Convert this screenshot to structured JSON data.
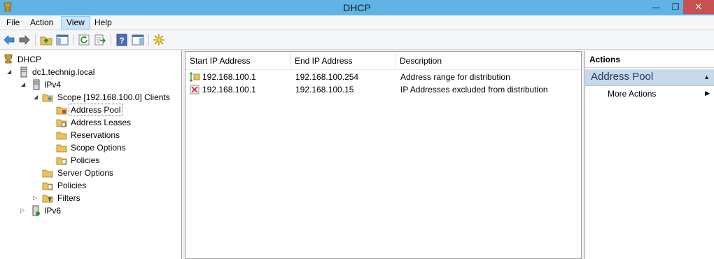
{
  "window": {
    "title": "DHCP",
    "min_glyph": "—",
    "max_glyph": "❐",
    "close_glyph": "✕"
  },
  "menu": {
    "file": "File",
    "action": "Action",
    "view": "View",
    "help": "Help"
  },
  "toolbar": {
    "icons": [
      "back-arrow-icon",
      "forward-arrow-icon",
      "up-folder-icon",
      "show-hide-tree-icon",
      "refresh-icon",
      "export-list-icon",
      "help-icon",
      "show-hide-action-pane-icon",
      "new-icon"
    ]
  },
  "tree": {
    "root": "DHCP",
    "server": "dc1.technig.local",
    "ipv4": "IPv4",
    "scope": "Scope [192.168.100.0] Clients",
    "address_pool": "Address Pool",
    "address_leases": "Address Leases",
    "reservations": "Reservations",
    "scope_options": "Scope Options",
    "scope_policies": "Policies",
    "server_options": "Server Options",
    "policies": "Policies",
    "filters": "Filters",
    "ipv6": "IPv6"
  },
  "list": {
    "columns": [
      "Start IP Address",
      "End IP Address",
      "Description"
    ],
    "rows": [
      {
        "start": "192.168.100.1",
        "end": "192.168.100.254",
        "description": "Address range for distribution",
        "icon": "address-range-icon"
      },
      {
        "start": "192.168.100.1",
        "end": "192.168.100.15",
        "description": "IP Addresses excluded from distribution",
        "icon": "exclusion-range-icon"
      }
    ]
  },
  "actions": {
    "title": "Actions",
    "section": "Address Pool",
    "more": "More Actions"
  },
  "colors": {
    "titlebar": "#5fb4e5",
    "close": "#c75050",
    "action_section": "#c9d9ec"
  }
}
